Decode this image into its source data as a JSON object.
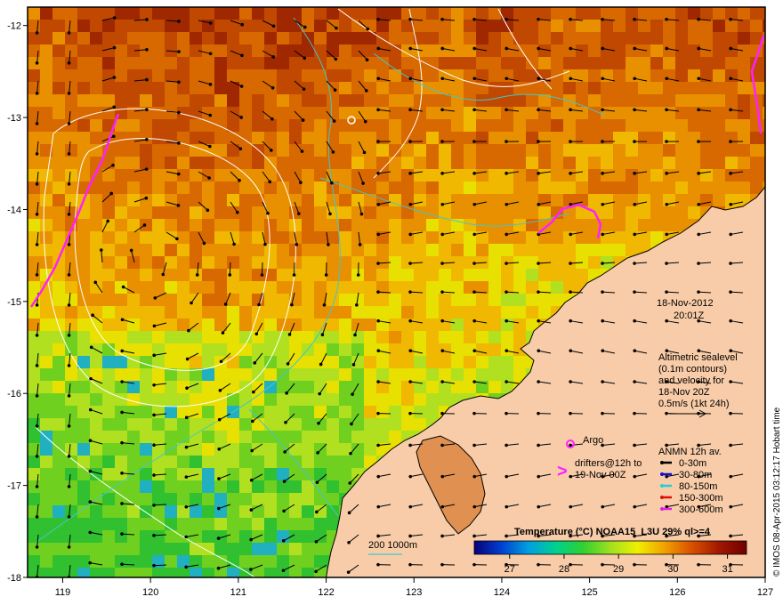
{
  "map": {
    "date": "18-Nov-2012",
    "time": "20:01Z",
    "lon_min": 118.6,
    "lon_max": 127,
    "lat_min": -18,
    "lat_max": -11.8,
    "x_ticks": [
      "119",
      "120",
      "121",
      "122",
      "123",
      "124",
      "125",
      "126",
      "127"
    ],
    "y_ticks": [
      "-12",
      "-13",
      "-14",
      "-15",
      "-16",
      "-17",
      "-18"
    ],
    "altimetry_lines": [
      "Altimetric sealevel",
      "(0.1m contours)",
      "and velocity for",
      "18-Nov 20Z",
      "0.5m/s (1kt 24h)"
    ],
    "argo_label": "Argo",
    "drifters_lines": [
      "drifters@12h to",
      "19-Nov 00Z"
    ],
    "anmn_title": "ANMN 12h av.",
    "anmn_items": [
      {
        "label": "0-30m",
        "color": "#000000"
      },
      {
        "label": "30-80m",
        "color": "#1010d0"
      },
      {
        "label": "80-150m",
        "color": "#20d0d0"
      },
      {
        "label": "150-300m",
        "color": "#e01010"
      },
      {
        "label": "300-600m",
        "color": "#e020e0"
      }
    ],
    "depth_contour_label": "200  1000m",
    "colorbar": {
      "title": "Temperature (°C) NOAA15_L3U 29% ql>=4",
      "ticks": [
        "27",
        "28",
        "29",
        "30",
        "31"
      ],
      "stops": [
        "#08007a",
        "#0040d0",
        "#00a0e0",
        "#00d090",
        "#30d030",
        "#a0e020",
        "#f0f000",
        "#f0a000",
        "#d85000",
        "#a01800",
        "#700000"
      ]
    },
    "credit": "© IMOS 08-Apr-2015 03:12:17 Hobart time",
    "colors": {
      "land": "#f8cca8",
      "contour": "#ffffff",
      "isobath": "#40c8c8",
      "drifter": "#ff20ff"
    }
  }
}
